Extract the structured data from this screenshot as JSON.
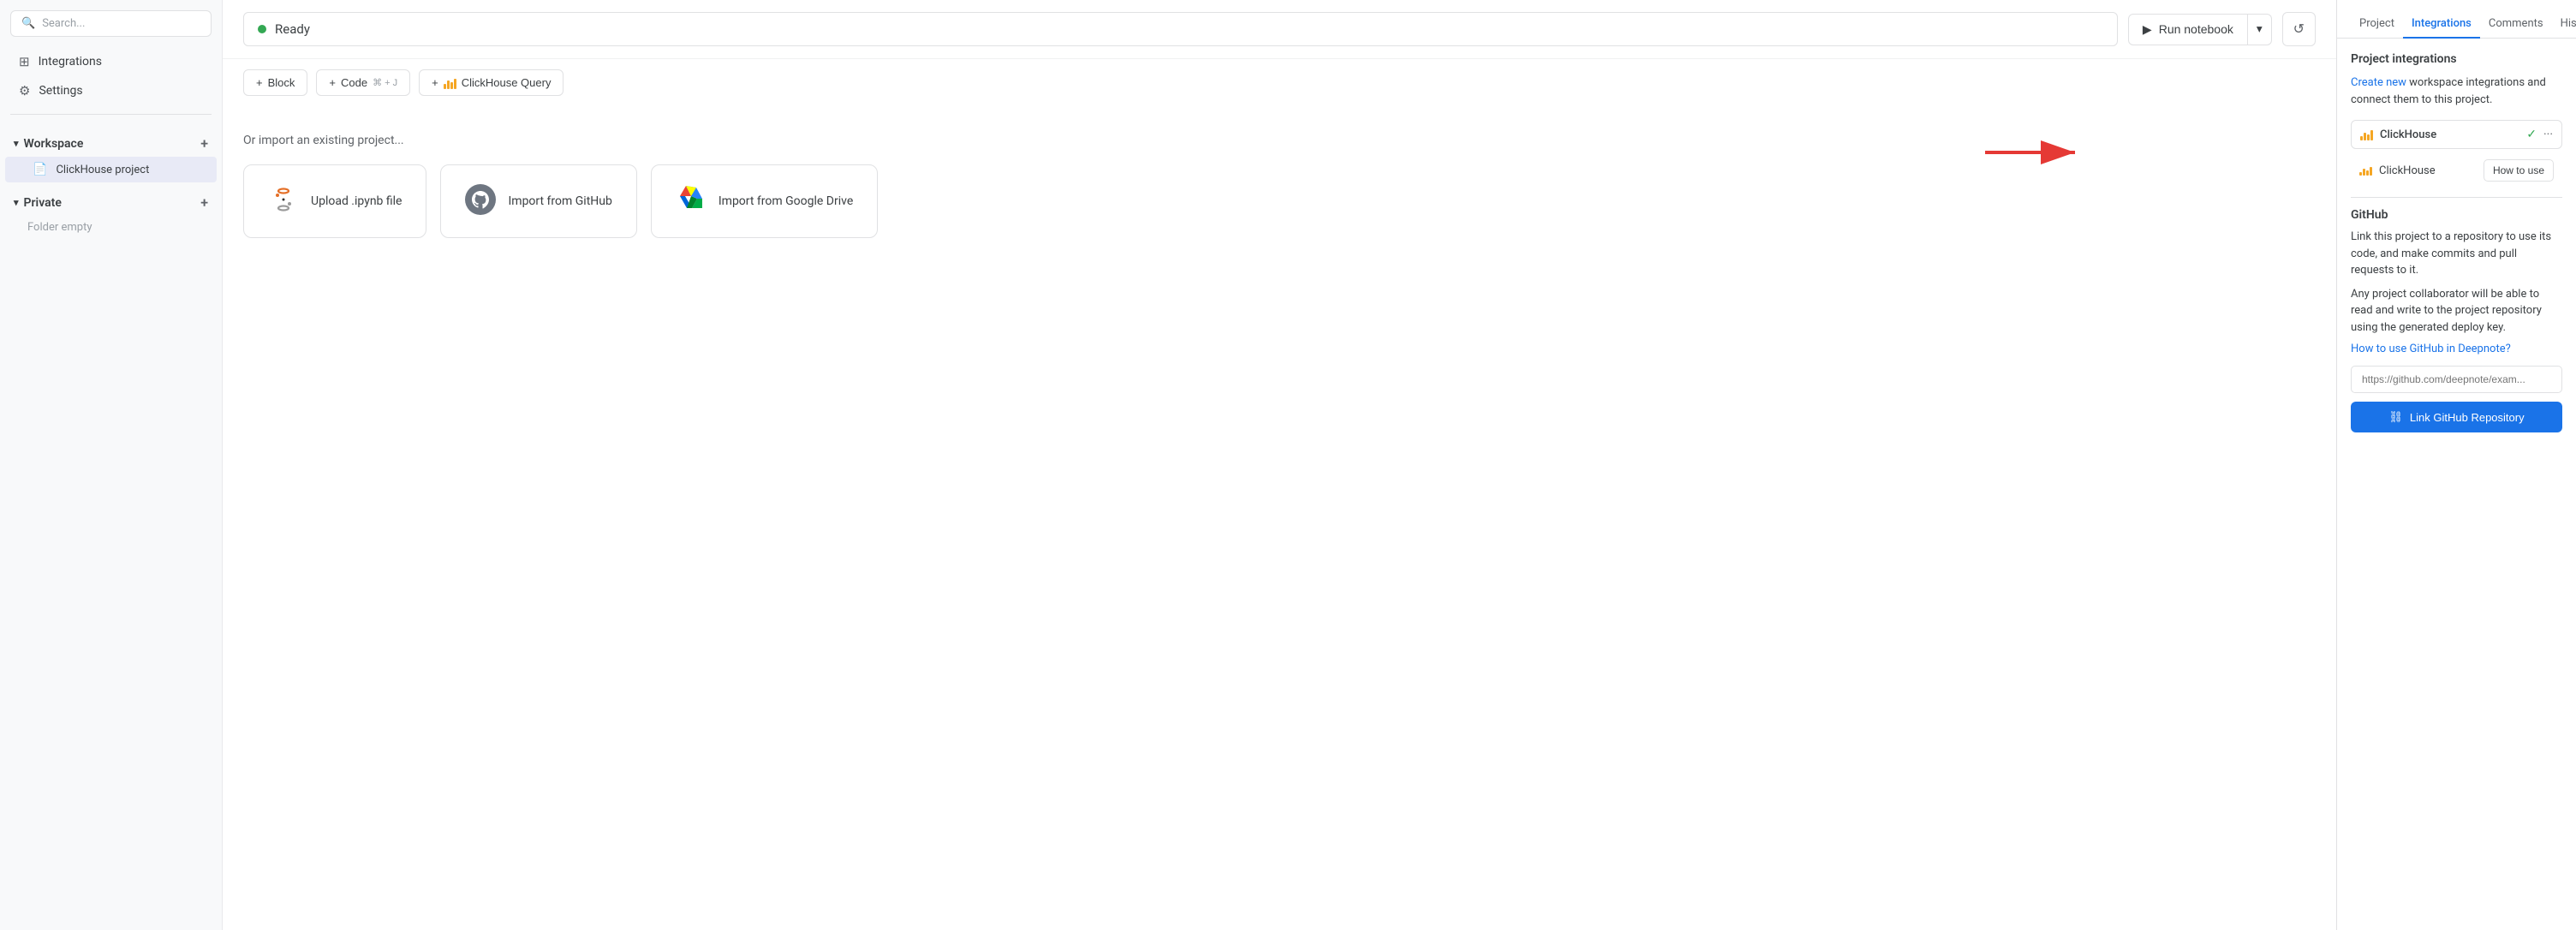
{
  "sidebar": {
    "search_placeholder": "Search...",
    "items": [
      {
        "label": "Integrations",
        "icon": "⊞"
      },
      {
        "label": "Settings",
        "icon": "⚙"
      }
    ],
    "workspace": {
      "label": "Workspace",
      "projects": [
        {
          "label": "ClickHouse project"
        }
      ]
    },
    "private": {
      "label": "Private",
      "folder_empty": "Folder empty"
    }
  },
  "toolbar": {
    "status": "Ready",
    "run_label": "Run notebook",
    "add_block": "+ Block",
    "add_code": "+ Code ⌘ + J",
    "add_query": "+ ClickHouse Query"
  },
  "import": {
    "label": "Or import an existing project...",
    "cards": [
      {
        "title": "Upload .ipynb file"
      },
      {
        "title": "Import from GitHub"
      },
      {
        "title": "Import from Google Drive"
      }
    ]
  },
  "right_panel": {
    "tabs": [
      "Project",
      "Integrations",
      "Comments",
      "History"
    ],
    "active_tab": "Integrations",
    "section_title": "Project integrations",
    "create_new_text": "Create new",
    "create_new_suffix": " workspace integrations and connect them to this project.",
    "integration": {
      "name": "ClickHouse",
      "sub_name": "ClickHouse",
      "how_to_use": "How to use"
    },
    "github": {
      "title": "GitHub",
      "desc1": "Link this project to a repository to use its code, and make commits and pull requests to it.",
      "desc2": "Any project collaborator will be able to read and write to the project repository using the generated deploy key.",
      "link_text": "How to use GitHub in Deepnote?",
      "input_placeholder": "https://github.com/deepnote/exam...",
      "btn_label": "Link GitHub Repository"
    }
  }
}
